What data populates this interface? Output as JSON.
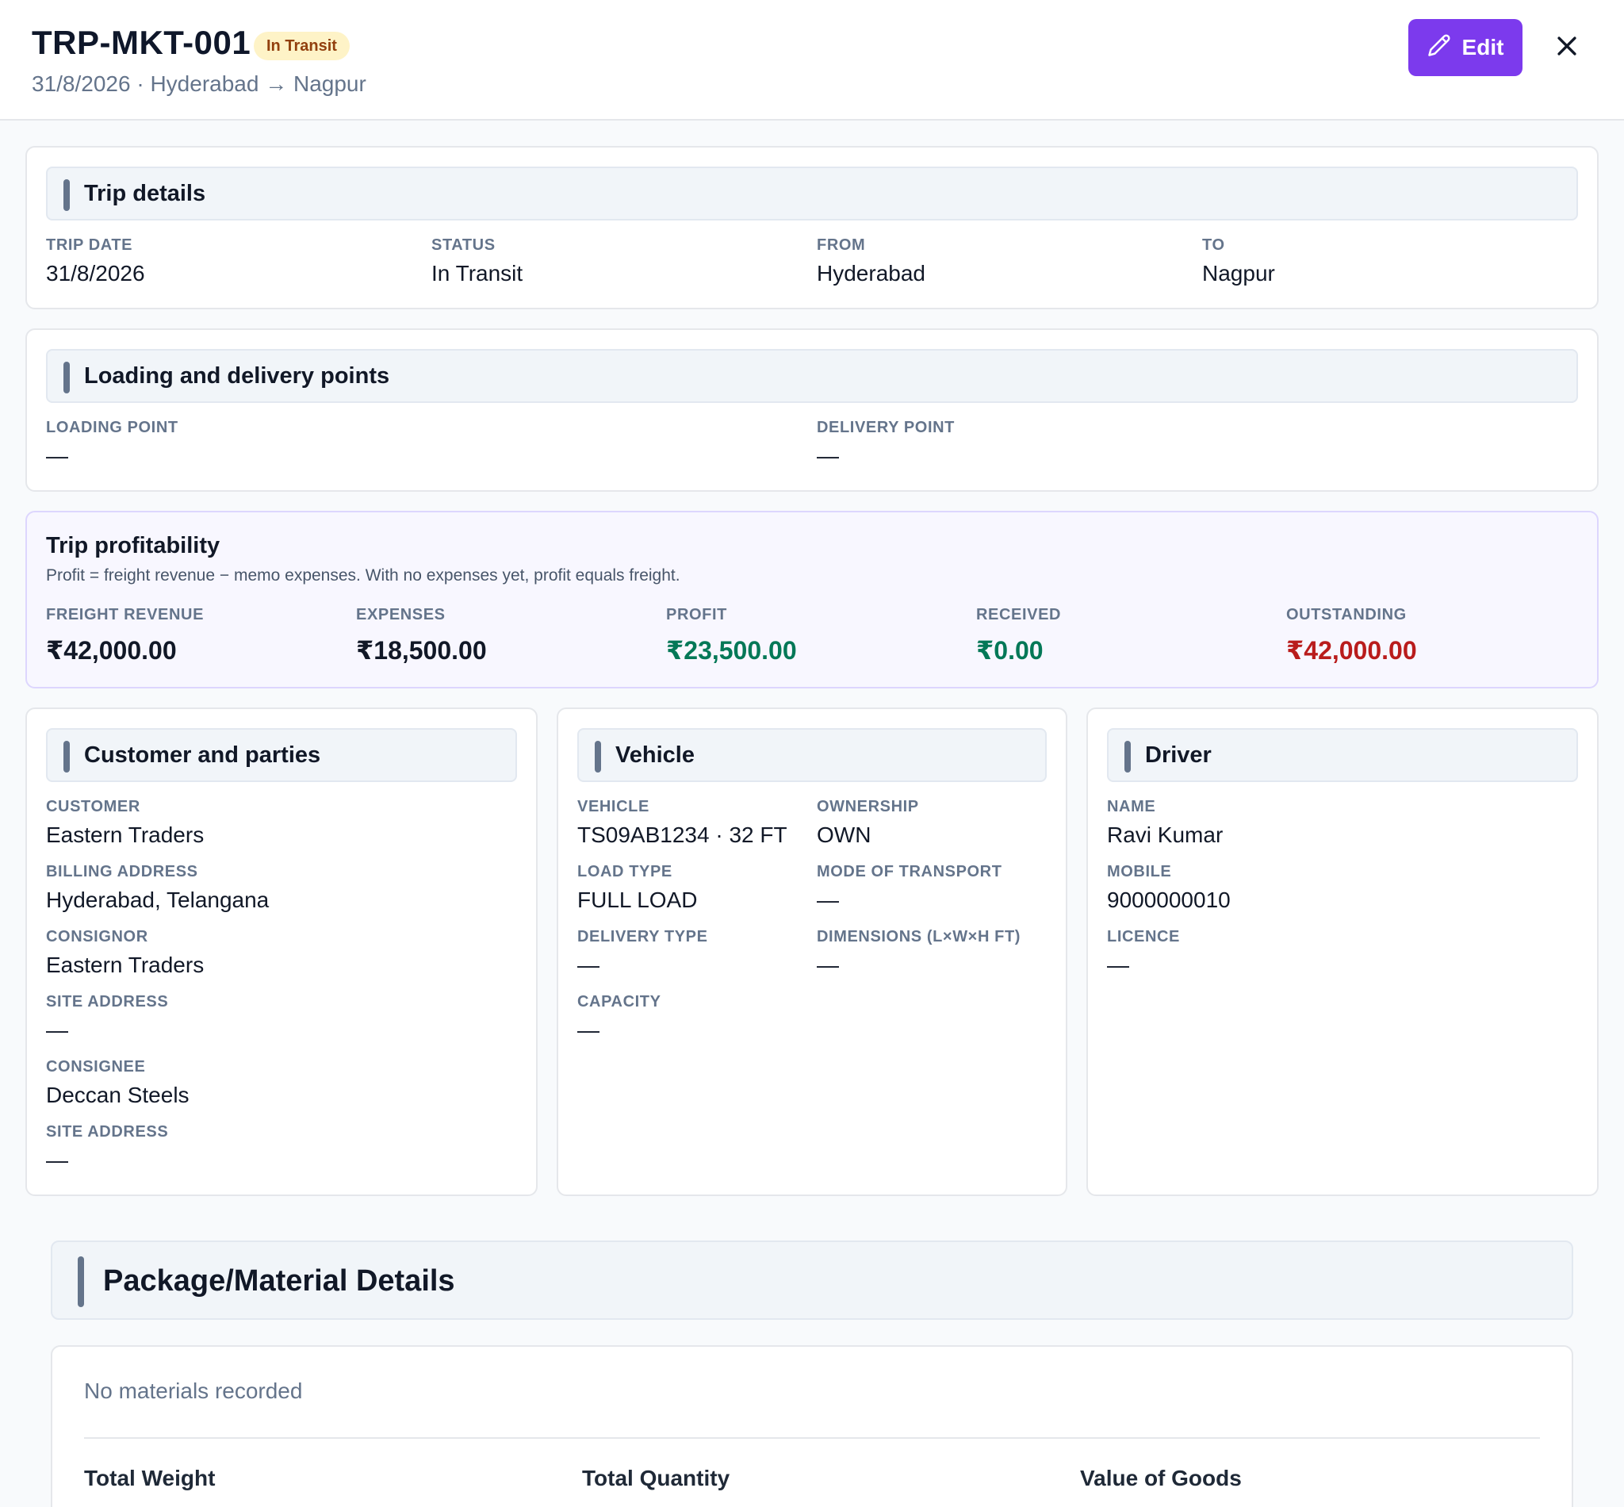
{
  "header": {
    "trip_id": "TRP-MKT-001",
    "status_badge": "In Transit",
    "subtitle": "31/8/2026 · Hyderabad → Nagpur",
    "edit_label": "Edit",
    "accent_color": "#7c3aed"
  },
  "trip_details": {
    "title": "Trip details",
    "trip_date_label": "TRIP DATE",
    "trip_date": "31/8/2026",
    "status_label": "STATUS",
    "status": "In Transit",
    "from_label": "FROM",
    "from": "Hyderabad",
    "to_label": "TO",
    "to": "Nagpur"
  },
  "points": {
    "title": "Loading and delivery points",
    "loading_label": "LOADING POINT",
    "loading": "—",
    "delivery_label": "DELIVERY POINT",
    "delivery": "—"
  },
  "profitability": {
    "title": "Trip profitability",
    "description": "Profit = freight revenue − memo expenses. With no expenses yet, profit equals freight.",
    "freight_label": "FREIGHT REVENUE",
    "freight": "₹42,000.00",
    "expenses_label": "EXPENSES",
    "expenses": "₹18,500.00",
    "profit_label": "PROFIT",
    "profit": "₹23,500.00",
    "received_label": "RECEIVED",
    "received": "₹0.00",
    "outstanding_label": "OUTSTANDING",
    "outstanding": "₹42,000.00",
    "positive_color": "#047857",
    "negative_color": "#b91c1c"
  },
  "customer": {
    "title": "Customer and parties",
    "customer_label": "CUSTOMER",
    "customer": "Eastern Traders",
    "billing_label": "BILLING ADDRESS",
    "billing": "Hyderabad, Telangana",
    "consignor_label": "CONSIGNOR",
    "consignor": "Eastern Traders",
    "consignor_site_label": "SITE ADDRESS",
    "consignor_site": "—",
    "consignee_label": "CONSIGNEE",
    "consignee": "Deccan Steels",
    "consignee_site_label": "SITE ADDRESS",
    "consignee_site": "—"
  },
  "vehicle": {
    "title": "Vehicle",
    "vehicle_label": "VEHICLE",
    "vehicle": "TS09AB1234 · 32 FT",
    "ownership_label": "OWNERSHIP",
    "ownership": "OWN",
    "load_type_label": "LOAD TYPE",
    "load_type": "FULL LOAD",
    "mode_label": "MODE OF TRANSPORT",
    "mode": "—",
    "delivery_type_label": "DELIVERY TYPE",
    "delivery_type": "—",
    "dimensions_label": "DIMENSIONS (L×W×H FT)",
    "dimensions": "—",
    "capacity_label": "CAPACITY",
    "capacity": "—"
  },
  "driver": {
    "title": "Driver",
    "name_label": "NAME",
    "name": "Ravi Kumar",
    "mobile_label": "MOBILE",
    "mobile": "9000000010",
    "licence_label": "LICENCE",
    "licence": "—"
  },
  "package": {
    "title": "Package/Material Details",
    "empty_text": "No materials recorded",
    "total_weight_label": "Total Weight",
    "total_quantity_label": "Total Quantity",
    "value_goods_label": "Value of Goods"
  }
}
